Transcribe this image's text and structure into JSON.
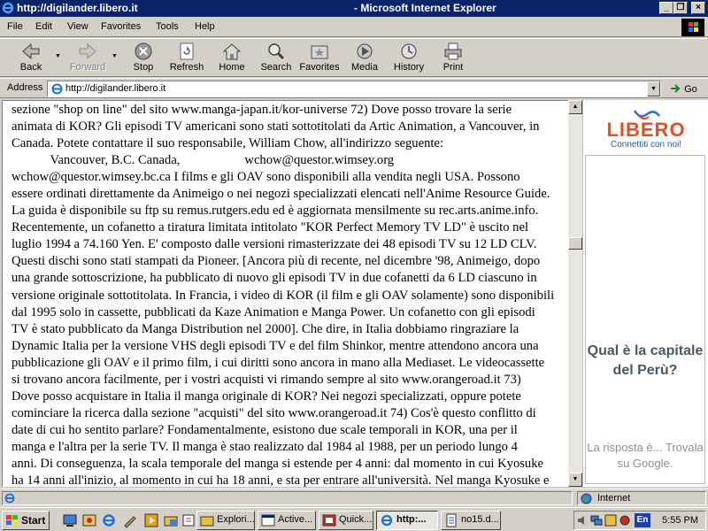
{
  "window": {
    "url_title": "http://digilander.libero.it",
    "app_title": "Microsoft Internet Explorer"
  },
  "menu": [
    "File",
    "Edit",
    "View",
    "Favorites",
    "Tools",
    "Help"
  ],
  "toolbar": {
    "back": "Back",
    "forward": "Forward",
    "stop": "Stop",
    "refresh": "Refresh",
    "home": "Home",
    "search": "Search",
    "favorites": "Favorites",
    "media": "Media",
    "history": "History",
    "print": "Print"
  },
  "address": {
    "label": "Address",
    "url": "http://digilander.libero.it",
    "go": "Go"
  },
  "content": {
    "lines": [
      "sezione \"shop on line\" del sito www.manga-japan.it/kor-universe 72) Dove posso trovare la serie",
      "animata di KOR? Gli episodi TV americani sono stati sottotitolati da Artic Animation, a Vancouver, in",
      "Canada. Potete contattare il suo responsabile, William Chow, all'indirizzo seguente:",
      "            Vancouver, B.C. Canada,                    wchow@questor.wimsey.org",
      "wchow@questor.wimsey.bc.ca I films e gli OAV sono disponibili alla vendita negli USA. Possono",
      "essere ordinati direttamente da Animeigo o nei negozi specializzati elencati nell'Anime Resource Guide.",
      "La guida è disponibile su ftp su remus.rutgers.edu ed è aggiornata mensilmente su rec.arts.anime.info.",
      "Recentemente, un cofanetto a tiratura limitata intitolato \"KOR Perfect Memory TV LD\" è uscito nel",
      "luglio 1994 a 74.160 Yen. E' composto dalle versioni rimasterizzate dei 48 episodi TV su 12 LD CLV.",
      "Questi dischi sono stati stampati da Pioneer. [Ancora più di recente, nel dicembre '98, Animeigo, dopo",
      "una grande sottoscrizione, ha pubblicato di nuovo gli episodi TV in due cofanetti da 6 LD ciascuno in",
      "versione originale sottotitolata. In Francia, i video di KOR (il film e gli OAV solamente) sono disponibili",
      "dal 1995 solo in cassette, pubblicati da Kaze Animation e Manga Power. Un cofanetto con gli episodi",
      "TV è stato pubblicato da Manga Distribution nel 2000]. Che dire, in Italia dobbiamo ringraziare la",
      "Dynamic Italia per la versione VHS degli episodi TV e del film Shinkor, mentre attendono ancora una",
      "pubblicazione gli OAV e il primo film, i cui diritti sono ancora in mano alla Mediaset. Le videocassette",
      "si trovano ancora facilmente, per i vostri acquisti vi rimando sempre al sito www.orangeroad.it 73)",
      "Dove posso acquistare in Italia il manga originale di KOR? Nei negozi specializzati, oppure potete",
      "cominciare la ricerca dalla sezione \"acquisti\" del sito www.orangeroad.it 74) Cos'è questo conflitto di",
      "date di cui ho sentito parlare? Fondamentalmente, esistono due scale temporali in KOR, una per il",
      "manga e l'altra per la serie TV. Il manga è stao realizzato dal 1984 al 1988, per un periodo lungo 4",
      "anni. Di conseguenza, la scala temporale del manga si estende per 4 anni: dal momento in cui Kyosuke",
      "ha 14 anni all'inizio, al momento in cui ha 18 anni, e sta per entrare all'università. Nel manga Kyosuke e"
    ]
  },
  "sidebar": {
    "logo_text": "LIBERO",
    "logo_tagline": "Connettiti con noi!",
    "ad_question": "Qual è la capitale del Perù?",
    "ad_answer": "La risposta è... Trovala su Google."
  },
  "status": {
    "zone": "Internet"
  },
  "taskbar": {
    "start": "Start",
    "tasks": [
      "Explori...",
      "Active...",
      "Quick...",
      "http:...",
      "no15.d..."
    ],
    "clock": "5:55 PM"
  }
}
